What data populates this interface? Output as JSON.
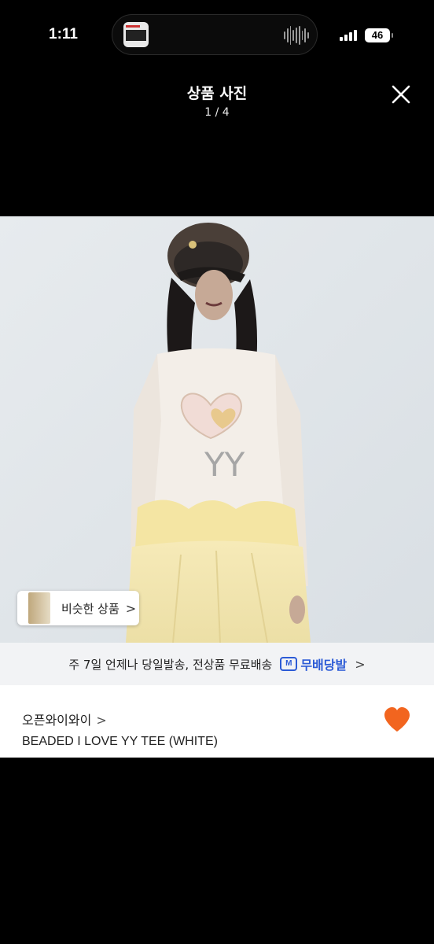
{
  "status_bar": {
    "time": "1:11",
    "battery": "46"
  },
  "viewer": {
    "title": "상품 사진",
    "counter": "1 / 4",
    "close_icon": "close-icon"
  },
  "photo": {
    "description_icon": "product-photo"
  },
  "similar": {
    "label": "비슷한 상품",
    "chevron": ">"
  },
  "delivery": {
    "text": "주 7일 언제나 당일발송, 전상품 무료배송",
    "badge_icon_letter": "M",
    "badge_label": "무배당발",
    "chevron": ">"
  },
  "product": {
    "shop_name": "오픈와이와이",
    "shop_chevron": ">",
    "title": "BEADED I LOVE YY TEE (WHITE)",
    "heart_color": "#f2651f"
  }
}
